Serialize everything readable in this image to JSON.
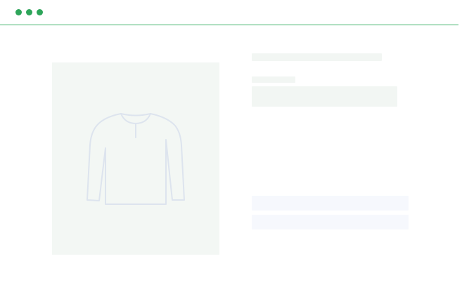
{
  "window": {
    "controls": [
      "close",
      "minimize",
      "maximize"
    ],
    "accent_color": "#2ea55a",
    "divider_color": "#3fb26a"
  },
  "product": {
    "image_icon": "long-sleeve-shirt-icon",
    "image_background": "#f3f7f4",
    "icon_stroke_color": "#dde4ee"
  },
  "details": {
    "state": "loading",
    "skeleton_color": "#f2f6f3",
    "action_skeleton_color": "#f6f8fd"
  }
}
